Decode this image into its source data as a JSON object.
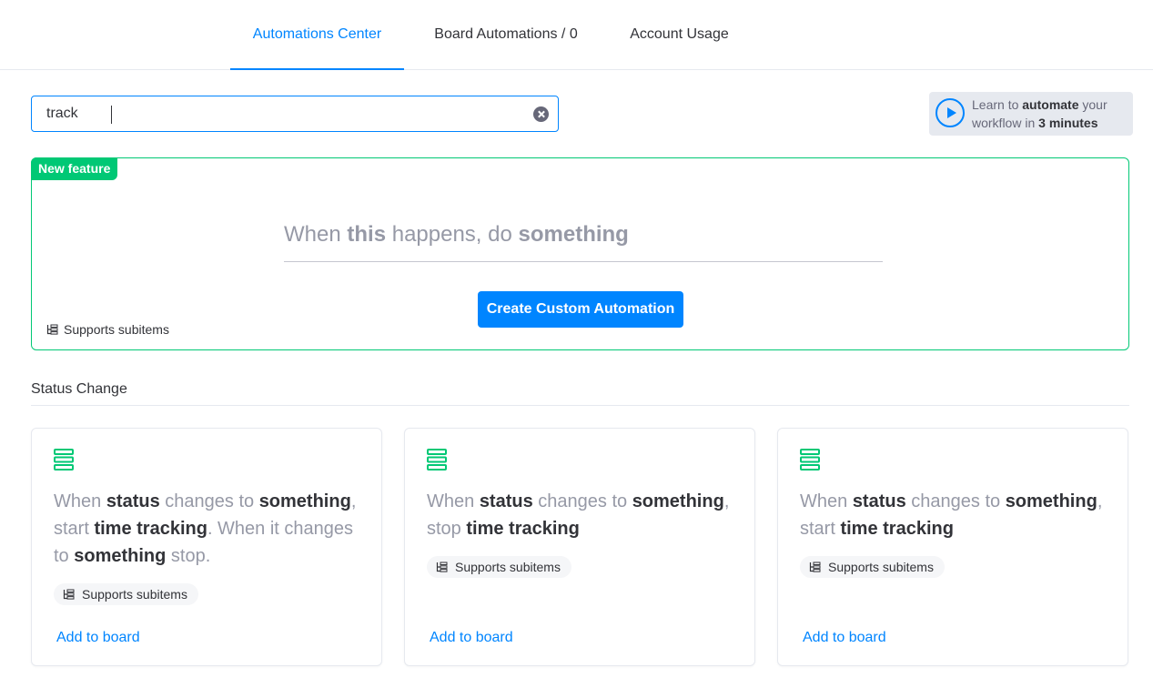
{
  "tabs": {
    "automations_center": "Automations Center",
    "board_automations": "Board Automations / 0",
    "account_usage": "Account Usage"
  },
  "search": {
    "value": "track"
  },
  "learn": {
    "prefix": "Learn to ",
    "bold1": "automate",
    "mid": " your workflow in ",
    "bold2": "3 minutes"
  },
  "custom": {
    "badge": "New feature",
    "sentence": {
      "part1": "When ",
      "bold1": "this",
      "part2": " happens, do ",
      "bold2": "something"
    },
    "button": "Create Custom Automation",
    "supports": "Supports subitems"
  },
  "section": {
    "title": "Status Change"
  },
  "recipes": [
    {
      "t1": "When ",
      "b1": "status",
      "t2": " changes to ",
      "b2": "something",
      "t3": ", start ",
      "b3": "time tracking",
      "t4": ". When it changes to ",
      "b4": "something",
      "t5": " stop.",
      "supports": "Supports subitems",
      "add": "Add to board"
    },
    {
      "t1": "When ",
      "b1": "status",
      "t2": " changes to ",
      "b2": "something",
      "t3": ", stop ",
      "b3": "time tracking",
      "supports": "Supports subitems",
      "add": "Add to board"
    },
    {
      "t1": "When ",
      "b1": "status",
      "t2": " changes to ",
      "b2": "something",
      "t3": ", start ",
      "b3": "time tracking",
      "supports": "Supports subitems",
      "add": "Add to board"
    }
  ],
  "colors": {
    "accent": "#0085ff",
    "green": "#00c875",
    "muted": "#9699a6",
    "text": "#323338"
  }
}
